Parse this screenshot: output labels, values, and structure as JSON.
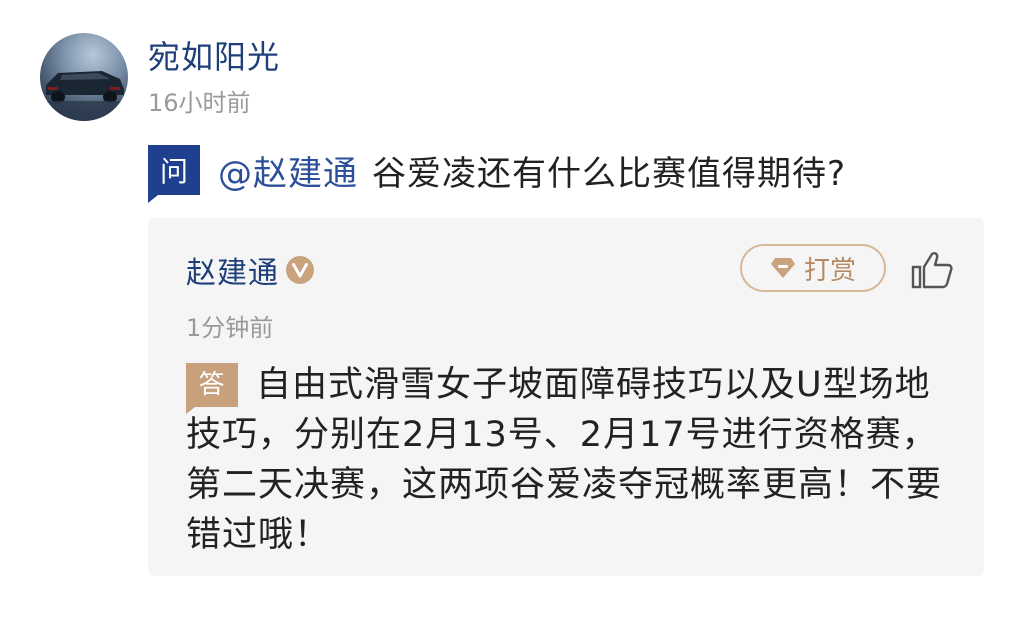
{
  "post": {
    "author": "宛如阳光",
    "time": "16小时前",
    "avatar_icon": "car-avatar"
  },
  "question": {
    "badge": "问",
    "mention": "@赵建通",
    "text": "谷爱凌还有什么比赛值得期待?"
  },
  "answer": {
    "author": "赵建通",
    "verified_icon": "verified-v-icon",
    "time": "1分钟前",
    "reward_label": "打赏",
    "badge": "答",
    "text": "自由式滑雪女子坡面障碍技巧以及U型场地技巧，分别在2月13号、2月17号进行资格赛，第二天决赛，这两项谷爱凌夺冠概率更高！不要错过哦！"
  },
  "colors": {
    "name_blue": "#1f3f7a",
    "question_badge": "#1f3f8f",
    "answer_badge": "#c8a07c",
    "reward_border": "#d9b898",
    "card_bg": "#f5f5f5"
  }
}
